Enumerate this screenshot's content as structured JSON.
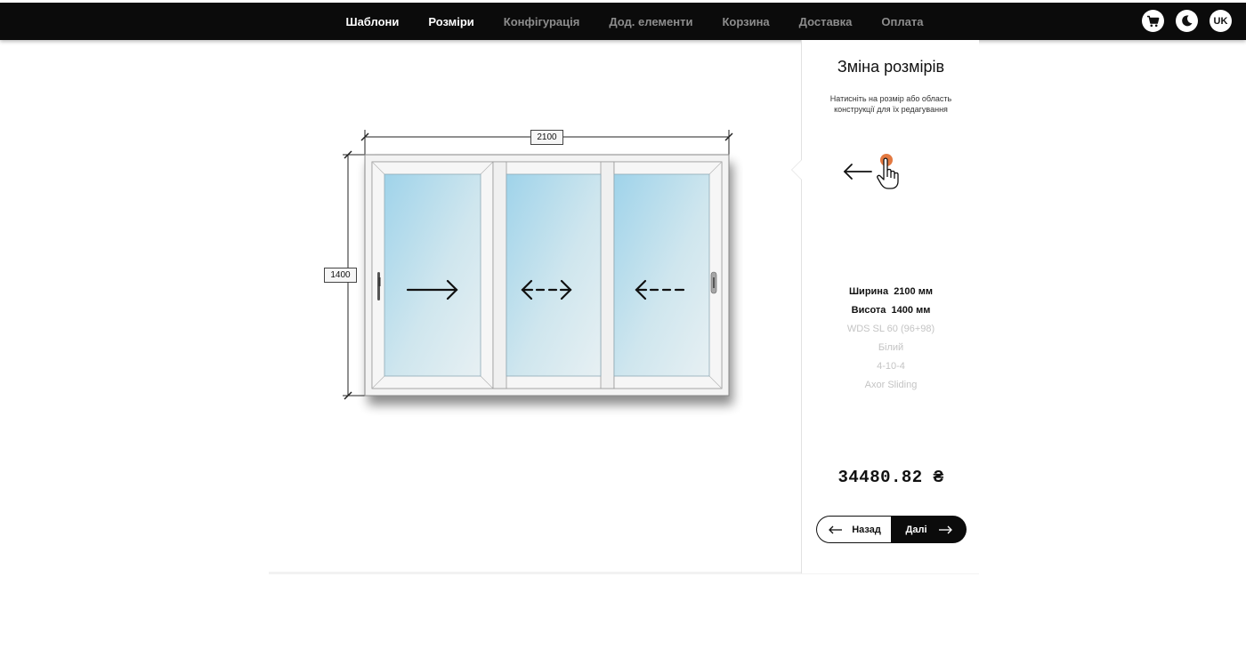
{
  "nav": {
    "items": [
      {
        "label": "Шаблони",
        "active": true
      },
      {
        "label": "Розміри",
        "active": true
      },
      {
        "label": "Конфігурація",
        "active": false
      },
      {
        "label": "Дод. елементи",
        "active": false
      },
      {
        "label": "Корзина",
        "active": false
      },
      {
        "label": "Доставка",
        "active": false
      },
      {
        "label": "Оплата",
        "active": false
      }
    ],
    "icons": [
      "cart-icon",
      "moon-icon"
    ],
    "language": "UK"
  },
  "window": {
    "width_label": "2100",
    "height_label": "1400",
    "sash_arrows": [
      "arrow-right",
      "arrow-both-dashed",
      "arrow-left-dashed"
    ]
  },
  "panel": {
    "title": "Зміна розмірів",
    "hint": "Натисніть на розмір або область конструкції для їх редагування",
    "width_label": "Ширина",
    "width_value": "2100 мм",
    "height_label": "Висота",
    "height_value": "1400 мм",
    "profile": "WDS SL 60 (96+98)",
    "color": "Білий",
    "glass": "4-10-4",
    "hardware": "Axor Sliding",
    "price": "34480.82 ₴",
    "back_label": "Назад",
    "next_label": "Далі"
  },
  "colors": {
    "nav_bg": "#0b0b0b",
    "accent_dot": "#e06a2c",
    "glass": "#bfe0ef"
  }
}
